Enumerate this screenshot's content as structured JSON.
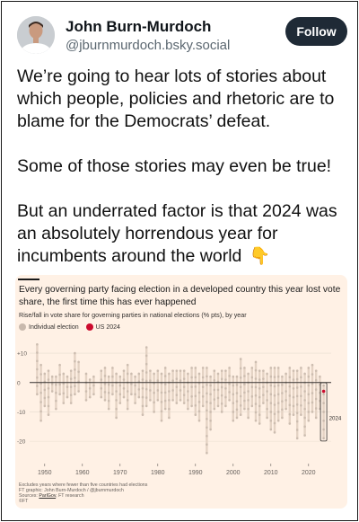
{
  "post": {
    "author_name": "John Burn-Murdoch",
    "author_handle": "@jburnmurdoch.bsky.social",
    "follow_label": "Follow",
    "paragraph1": "We’re going to hear lots of stories about which people, policies and rhetoric are to blame for the Democrats’ defeat.",
    "paragraph2": "Some of those stories may even be true!",
    "paragraph3": "But an underrated factor is that 2024 was an absolutely horrendous year for incumbents around the world",
    "emoji": "👇"
  },
  "colors": {
    "card_bg": "#fff1e5",
    "individual_dot": "#c8b9ad",
    "us_dot": "#cc0a2d",
    "follow_bg": "#1f2a36"
  },
  "chart_data": {
    "type": "scatter",
    "title": "Every governing party facing election in a developed country this year lost vote share, the first time this has ever happened",
    "subtitle": "Rise/fall in vote share for governing parties in national elections (% pts), by year",
    "legend": [
      {
        "name": "Individual election",
        "color": "#c8b9ad"
      },
      {
        "name": "US 2024",
        "color": "#cc0a2d"
      }
    ],
    "y_ticks": [
      "+10",
      "0",
      "-10",
      "-20"
    ],
    "y_tick_values": [
      10,
      0,
      -10,
      -20
    ],
    "x_ticks": [
      "1950",
      "1960",
      "1970",
      "1980",
      "1990",
      "2000",
      "2010",
      "2020"
    ],
    "x_tick_values": [
      1950,
      1960,
      1970,
      1980,
      1990,
      2000,
      2010,
      2020
    ],
    "xlim": [
      1946,
      2026
    ],
    "ylim": [
      -27,
      14
    ],
    "highlight_label": "2024",
    "year_ranges": [
      [
        1948,
        -4,
        13
      ],
      [
        1949,
        -13,
        6
      ],
      [
        1950,
        -8,
        3
      ],
      [
        1951,
        -11,
        4
      ],
      [
        1952,
        -3,
        2
      ],
      [
        1953,
        -9,
        2
      ],
      [
        1954,
        -4,
        6
      ],
      [
        1955,
        -7,
        3
      ],
      [
        1956,
        -5,
        2
      ],
      [
        1957,
        -7,
        4
      ],
      [
        1958,
        -4,
        10
      ],
      [
        1959,
        -3,
        7
      ],
      [
        1961,
        -6,
        3
      ],
      [
        1962,
        -5,
        1
      ],
      [
        1963,
        -4,
        2
      ],
      [
        1965,
        -5,
        4
      ],
      [
        1966,
        -6,
        5
      ],
      [
        1967,
        -9,
        2
      ],
      [
        1968,
        -4,
        5
      ],
      [
        1969,
        -12,
        3
      ],
      [
        1970,
        -7,
        2
      ],
      [
        1971,
        -5,
        4
      ],
      [
        1972,
        -9,
        6
      ],
      [
        1973,
        -4,
        3
      ],
      [
        1974,
        -7,
        2
      ],
      [
        1975,
        -5,
        3
      ],
      [
        1976,
        -11,
        4
      ],
      [
        1977,
        -8,
        12
      ],
      [
        1978,
        -6,
        4
      ],
      [
        1979,
        -10,
        3
      ],
      [
        1980,
        -6,
        4
      ],
      [
        1981,
        -13,
        3
      ],
      [
        1982,
        -9,
        5
      ],
      [
        1983,
        -12,
        3
      ],
      [
        1984,
        -6,
        4
      ],
      [
        1985,
        -7,
        4
      ],
      [
        1986,
        -6,
        4
      ],
      [
        1987,
        -7,
        4
      ],
      [
        1988,
        -9,
        3
      ],
      [
        1989,
        -8,
        5
      ],
      [
        1990,
        -11,
        5
      ],
      [
        1991,
        -13,
        3
      ],
      [
        1992,
        -8,
        5
      ],
      [
        1993,
        -24,
        5
      ],
      [
        1994,
        -16,
        2
      ],
      [
        1995,
        -9,
        4
      ],
      [
        1996,
        -8,
        3
      ],
      [
        1997,
        -10,
        4
      ],
      [
        1998,
        -8,
        4
      ],
      [
        1999,
        -6,
        5
      ],
      [
        2000,
        -13,
        2
      ],
      [
        2001,
        -12,
        2
      ],
      [
        2002,
        -11,
        8
      ],
      [
        2003,
        -9,
        5
      ],
      [
        2004,
        -12,
        3
      ],
      [
        2005,
        -8,
        5
      ],
      [
        2006,
        -13,
        7
      ],
      [
        2007,
        -14,
        4
      ],
      [
        2008,
        -7,
        4
      ],
      [
        2009,
        -12,
        3
      ],
      [
        2010,
        -16,
        5
      ],
      [
        2011,
        -17,
        5
      ],
      [
        2012,
        -13,
        5
      ],
      [
        2013,
        -12,
        2
      ],
      [
        2014,
        -9,
        3
      ],
      [
        2015,
        -14,
        5
      ],
      [
        2016,
        -11,
        4
      ],
      [
        2017,
        -19,
        4
      ],
      [
        2018,
        -11,
        5
      ],
      [
        2019,
        -18,
        3
      ],
      [
        2020,
        -13,
        5
      ],
      [
        2021,
        -10,
        6
      ],
      [
        2022,
        -12,
        4
      ],
      [
        2023,
        -9,
        2
      ],
      [
        2024,
        -19,
        -1
      ]
    ],
    "us_2024": -3,
    "footnotes": [
      "Excludes years where fewer than five countries had elections",
      "FT graphic: John Burn-Murdoch / @jburnmurdoch"
    ],
    "sources_label": "Sources: ",
    "sources_link": "ParlGov",
    "sources_tail": ", FT research",
    "ft_mark": "©FT"
  }
}
